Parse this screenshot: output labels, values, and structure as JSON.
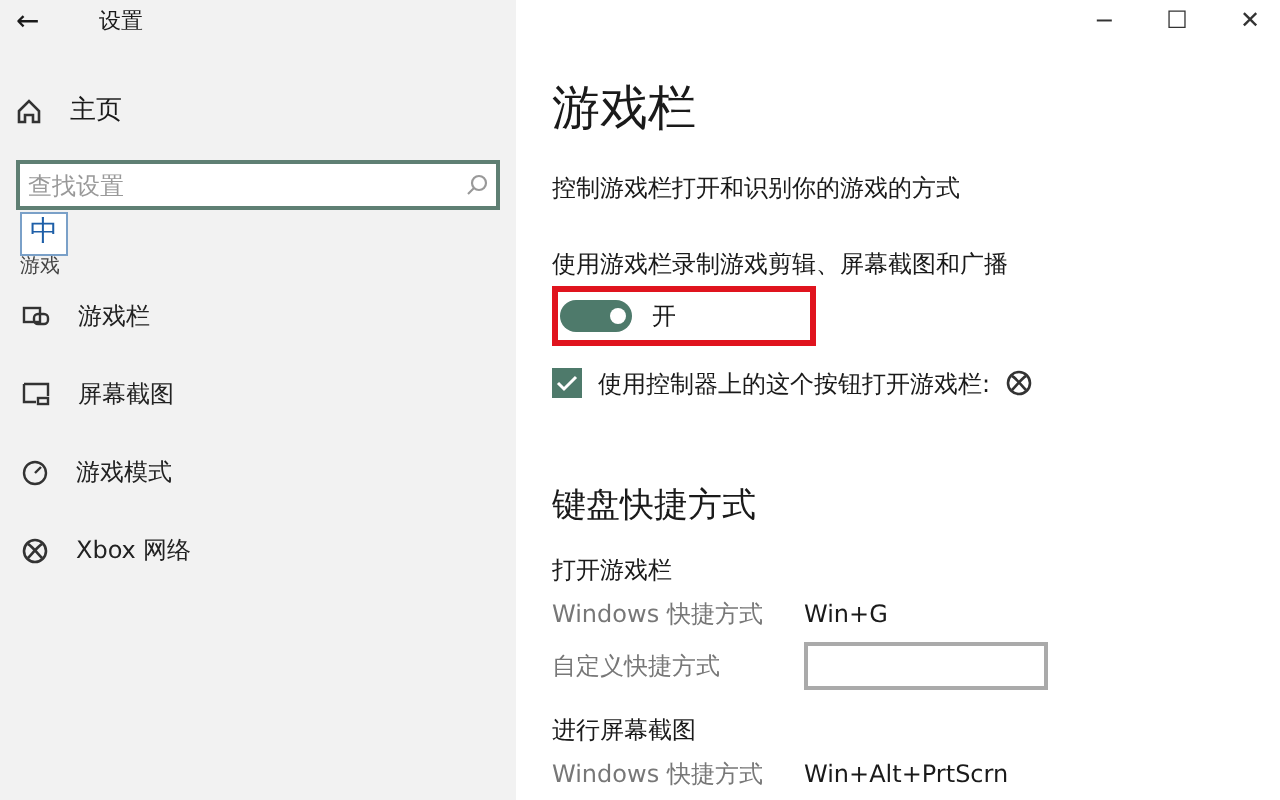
{
  "window": {
    "title": "设置",
    "back": "←",
    "controls": [
      "−",
      "☐",
      "✕"
    ]
  },
  "sidebar": {
    "home": "主页",
    "search": {
      "placeholder": "查找设置"
    },
    "ime": "中",
    "section": "游戏",
    "items": [
      {
        "label": "游戏栏",
        "kind": "gamebar"
      },
      {
        "label": "屏幕截图",
        "kind": "capture"
      },
      {
        "label": "游戏模式",
        "kind": "gauge"
      },
      {
        "label": "Xbox 网络",
        "kind": "xbox"
      }
    ]
  },
  "content": {
    "title": "游戏栏",
    "description": "控制游戏栏打开和识别你的游戏的方式",
    "toggle": {
      "label": "使用游戏栏录制游戏剪辑、屏幕截图和广播",
      "on": true,
      "state_text": "开",
      "highlighted": true
    },
    "checkbox": {
      "label": "使用控制器上的这个按钮打开游戏栏:",
      "checked": true
    },
    "shortcuts_title": "键盘快捷方式",
    "groups": [
      {
        "title": "打开游戏栏",
        "rows": [
          {
            "label": "Windows 快捷方式",
            "value": "Win+G",
            "kind": "text"
          },
          {
            "label": "自定义快捷方式",
            "kind": "input"
          }
        ]
      },
      {
        "title": "进行屏幕截图",
        "rows": [
          {
            "label": "Windows 快捷方式",
            "value": "Win+Alt+PrtScrn",
            "kind": "text"
          }
        ]
      }
    ]
  }
}
